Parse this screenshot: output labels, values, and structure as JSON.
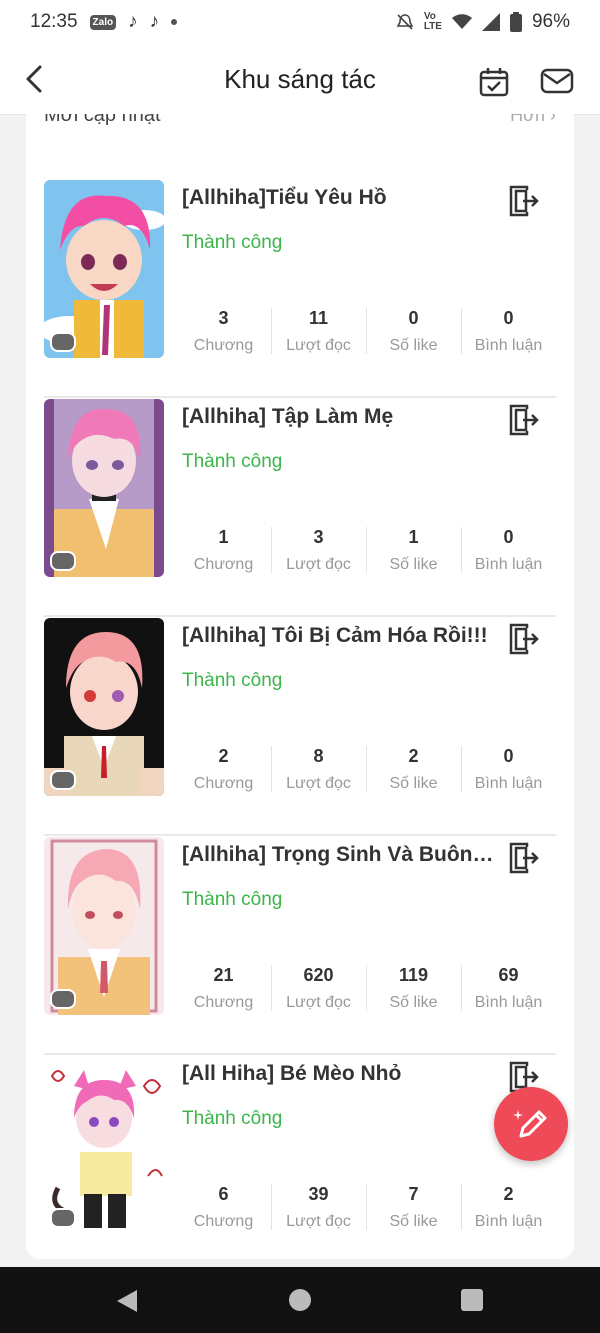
{
  "status_bar": {
    "time": "12:35",
    "battery": "96%",
    "app_icons": [
      "zalo-icon",
      "tiktok-icon",
      "tiktok-icon"
    ]
  },
  "header": {
    "title": "Khu sáng tác"
  },
  "section": {
    "title": "Mới cập nhật",
    "more": "Hơn"
  },
  "stat_labels": {
    "chapters": "Chương",
    "reads": "Lượt đọc",
    "likes": "Số like",
    "comments": "Bình luận"
  },
  "stories": [
    {
      "title": "[Allhiha]Tiểu Yêu Hồ",
      "status": "Thành công",
      "chapters": "3",
      "reads": "11",
      "likes": "0",
      "comments": "0"
    },
    {
      "title": "[Allhiha] Tập Làm Mẹ",
      "status": "Thành công",
      "chapters": "1",
      "reads": "3",
      "likes": "1",
      "comments": "0"
    },
    {
      "title": "[Allhiha] Tôi Bị Cảm Hóa Rồi!!!",
      "status": "Thành công",
      "chapters": "2",
      "reads": "8",
      "likes": "2",
      "comments": "0"
    },
    {
      "title": "[Allhiha] Trọng Sinh Và Buông ...",
      "status": "Thành công",
      "chapters": "21",
      "reads": "620",
      "likes": "119",
      "comments": "69"
    },
    {
      "title": "[All Hiha] Bé Mèo Nhỏ",
      "status": "Thành công",
      "chapters": "6",
      "reads": "39",
      "likes": "7",
      "comments": "2"
    }
  ],
  "colors": {
    "accent_green": "#3cb54a",
    "fab": "#ef4a58"
  },
  "icons": {
    "back": "back-arrow-icon",
    "calendar": "calendar-check-icon",
    "mail": "mail-icon",
    "exit": "exit-icon",
    "fab": "pencil-sparkle-icon"
  }
}
